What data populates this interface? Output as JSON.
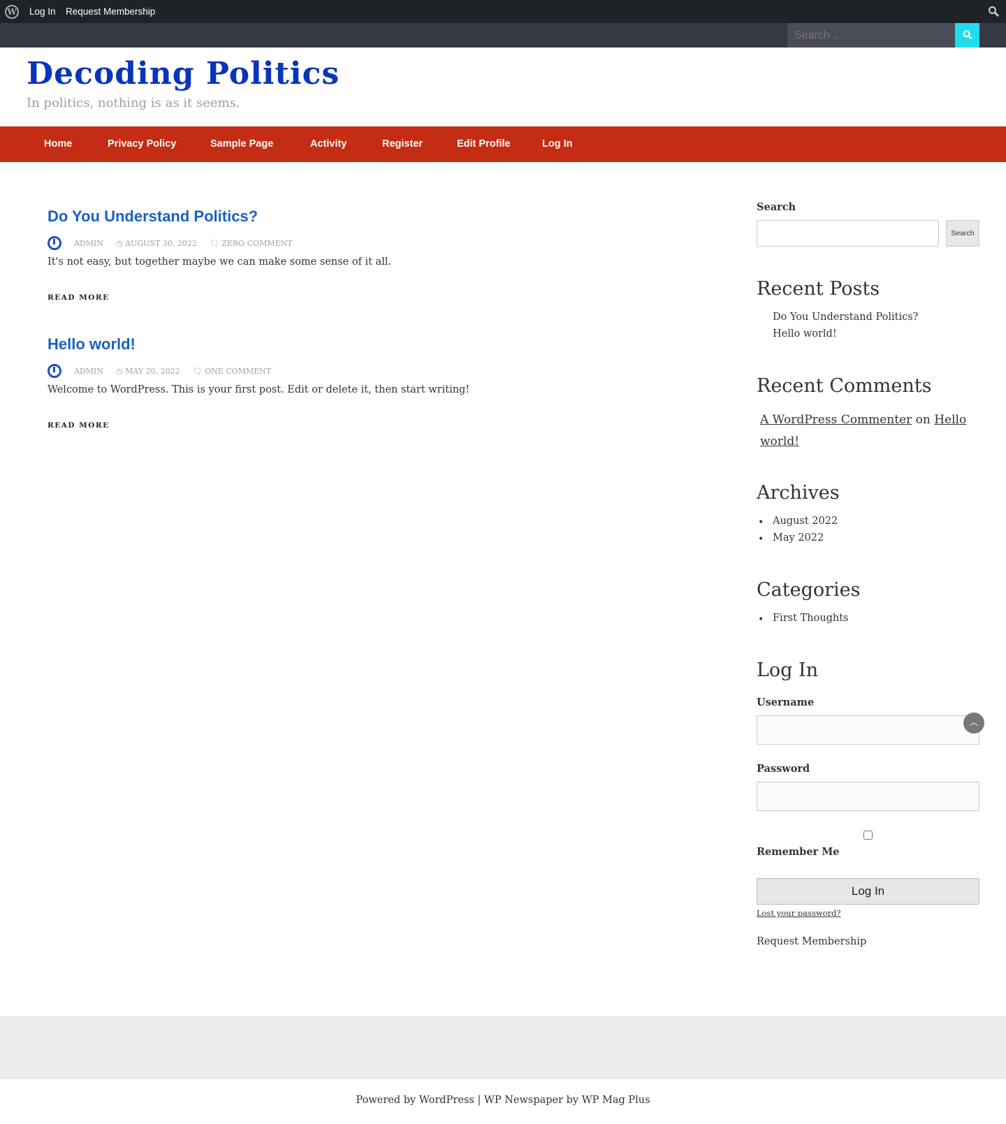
{
  "adminbar": {
    "login": "Log In",
    "request": "Request Membership"
  },
  "topsearch": {
    "placeholder": "Search ..."
  },
  "site": {
    "title": "Decoding Politics",
    "tagline": "In politics, nothing is as it seems."
  },
  "nav": [
    "Home",
    "Privacy Policy",
    "Sample Page",
    "Activity",
    "Register",
    "Edit Profile",
    "Log In"
  ],
  "posts": [
    {
      "title": "Do You Understand Politics?",
      "author": "ADMIN",
      "date": "AUGUST 30, 2022",
      "comments": "ZERO COMMENT",
      "excerpt": "It's not easy, but together maybe we can make some sense of it all.",
      "more": "READ MORE"
    },
    {
      "title": "Hello world!",
      "author": "ADMIN",
      "date": "MAY 20, 2022",
      "comments": "ONE COMMENT",
      "excerpt": "Welcome to WordPress. This is your first post. Edit or delete it, then start writing!",
      "more": "READ MORE"
    }
  ],
  "sidebar": {
    "search_label": "Search",
    "search_button": "Search",
    "recent_posts": {
      "title": "Recent Posts",
      "items": [
        "Do You Understand Politics?",
        "Hello world!"
      ]
    },
    "recent_comments": {
      "title": "Recent Comments",
      "author": "A WordPress Commenter",
      "on": "on",
      "post1": "Hello",
      "post2": "world!"
    },
    "archives": {
      "title": "Archives",
      "items": [
        "August 2022",
        "May 2022"
      ]
    },
    "categories": {
      "title": "Categories",
      "items": [
        "First Thoughts"
      ]
    },
    "login": {
      "title": "Log In",
      "username": "Username",
      "password": "Password",
      "remember": "Remember Me",
      "button": "Log In",
      "lost": "Lost your password?",
      "request": "Request Membership"
    }
  },
  "footer": {
    "credit": "Powered by WordPress | WP Newspaper by WP Mag Plus"
  }
}
